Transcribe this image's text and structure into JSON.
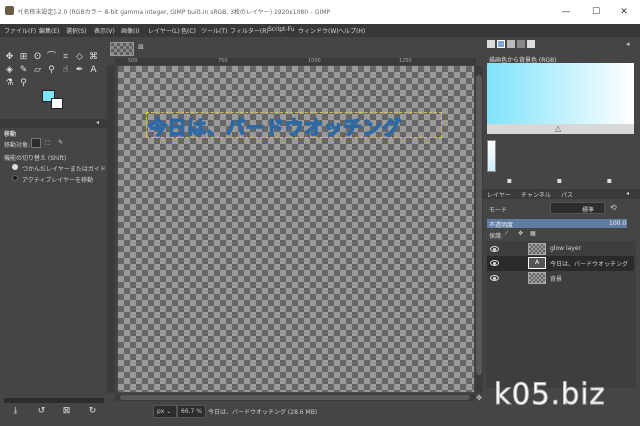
{
  "window": {
    "title": "*[名称未設定]-2.0 (RGBカラー 8-bit gamma integer, GIMP built-in sRGB, 3枚のレイヤー) 1920x1080 – GIMP",
    "minimize": "—",
    "maximize": "☐",
    "close": "✕"
  },
  "menu": [
    "ファイル(F)",
    "編集(E)",
    "選択(S)",
    "表示(V)",
    "画像(I)",
    "レイヤー(L)",
    "色(C)",
    "ツール(T)",
    "フィルター(R)",
    "Script-Fu",
    "ウィンドウ(W)",
    "ヘルプ(H)"
  ],
  "toolbox": {
    "colors": {
      "foreground": "#7fe3fb",
      "background": "#ffffff"
    },
    "options_title": "移動",
    "move_target_label": "移動対象:",
    "toggle_label": "機能の切り替え (Shift)",
    "option1": "つかんだレイヤーまたはガイド",
    "option2": "アクティブレイヤーを移動"
  },
  "canvas": {
    "tab_close": "⊠",
    "ruler_ticks": [
      "500",
      "750",
      "1000",
      "1250"
    ],
    "text": "今日は、バードウオッチング"
  },
  "statusbar": {
    "unit": "px",
    "zoom": "66.7 %",
    "layer_info": "今日は、バードウオッチング (28.6 MB)"
  },
  "gradient": {
    "name": "描画色から背景色 (RGB)"
  },
  "layers": {
    "tabs": [
      "レイヤー",
      "チャンネル",
      "パス"
    ],
    "mode_label": "モード",
    "mode_value": "標準",
    "opacity_label": "不透明度",
    "opacity_value": "100.0",
    "lock_label": "保護:",
    "items": [
      "glow layer",
      "今日は、バードウオッチング",
      "背景"
    ]
  },
  "watermark": "k05.biz"
}
